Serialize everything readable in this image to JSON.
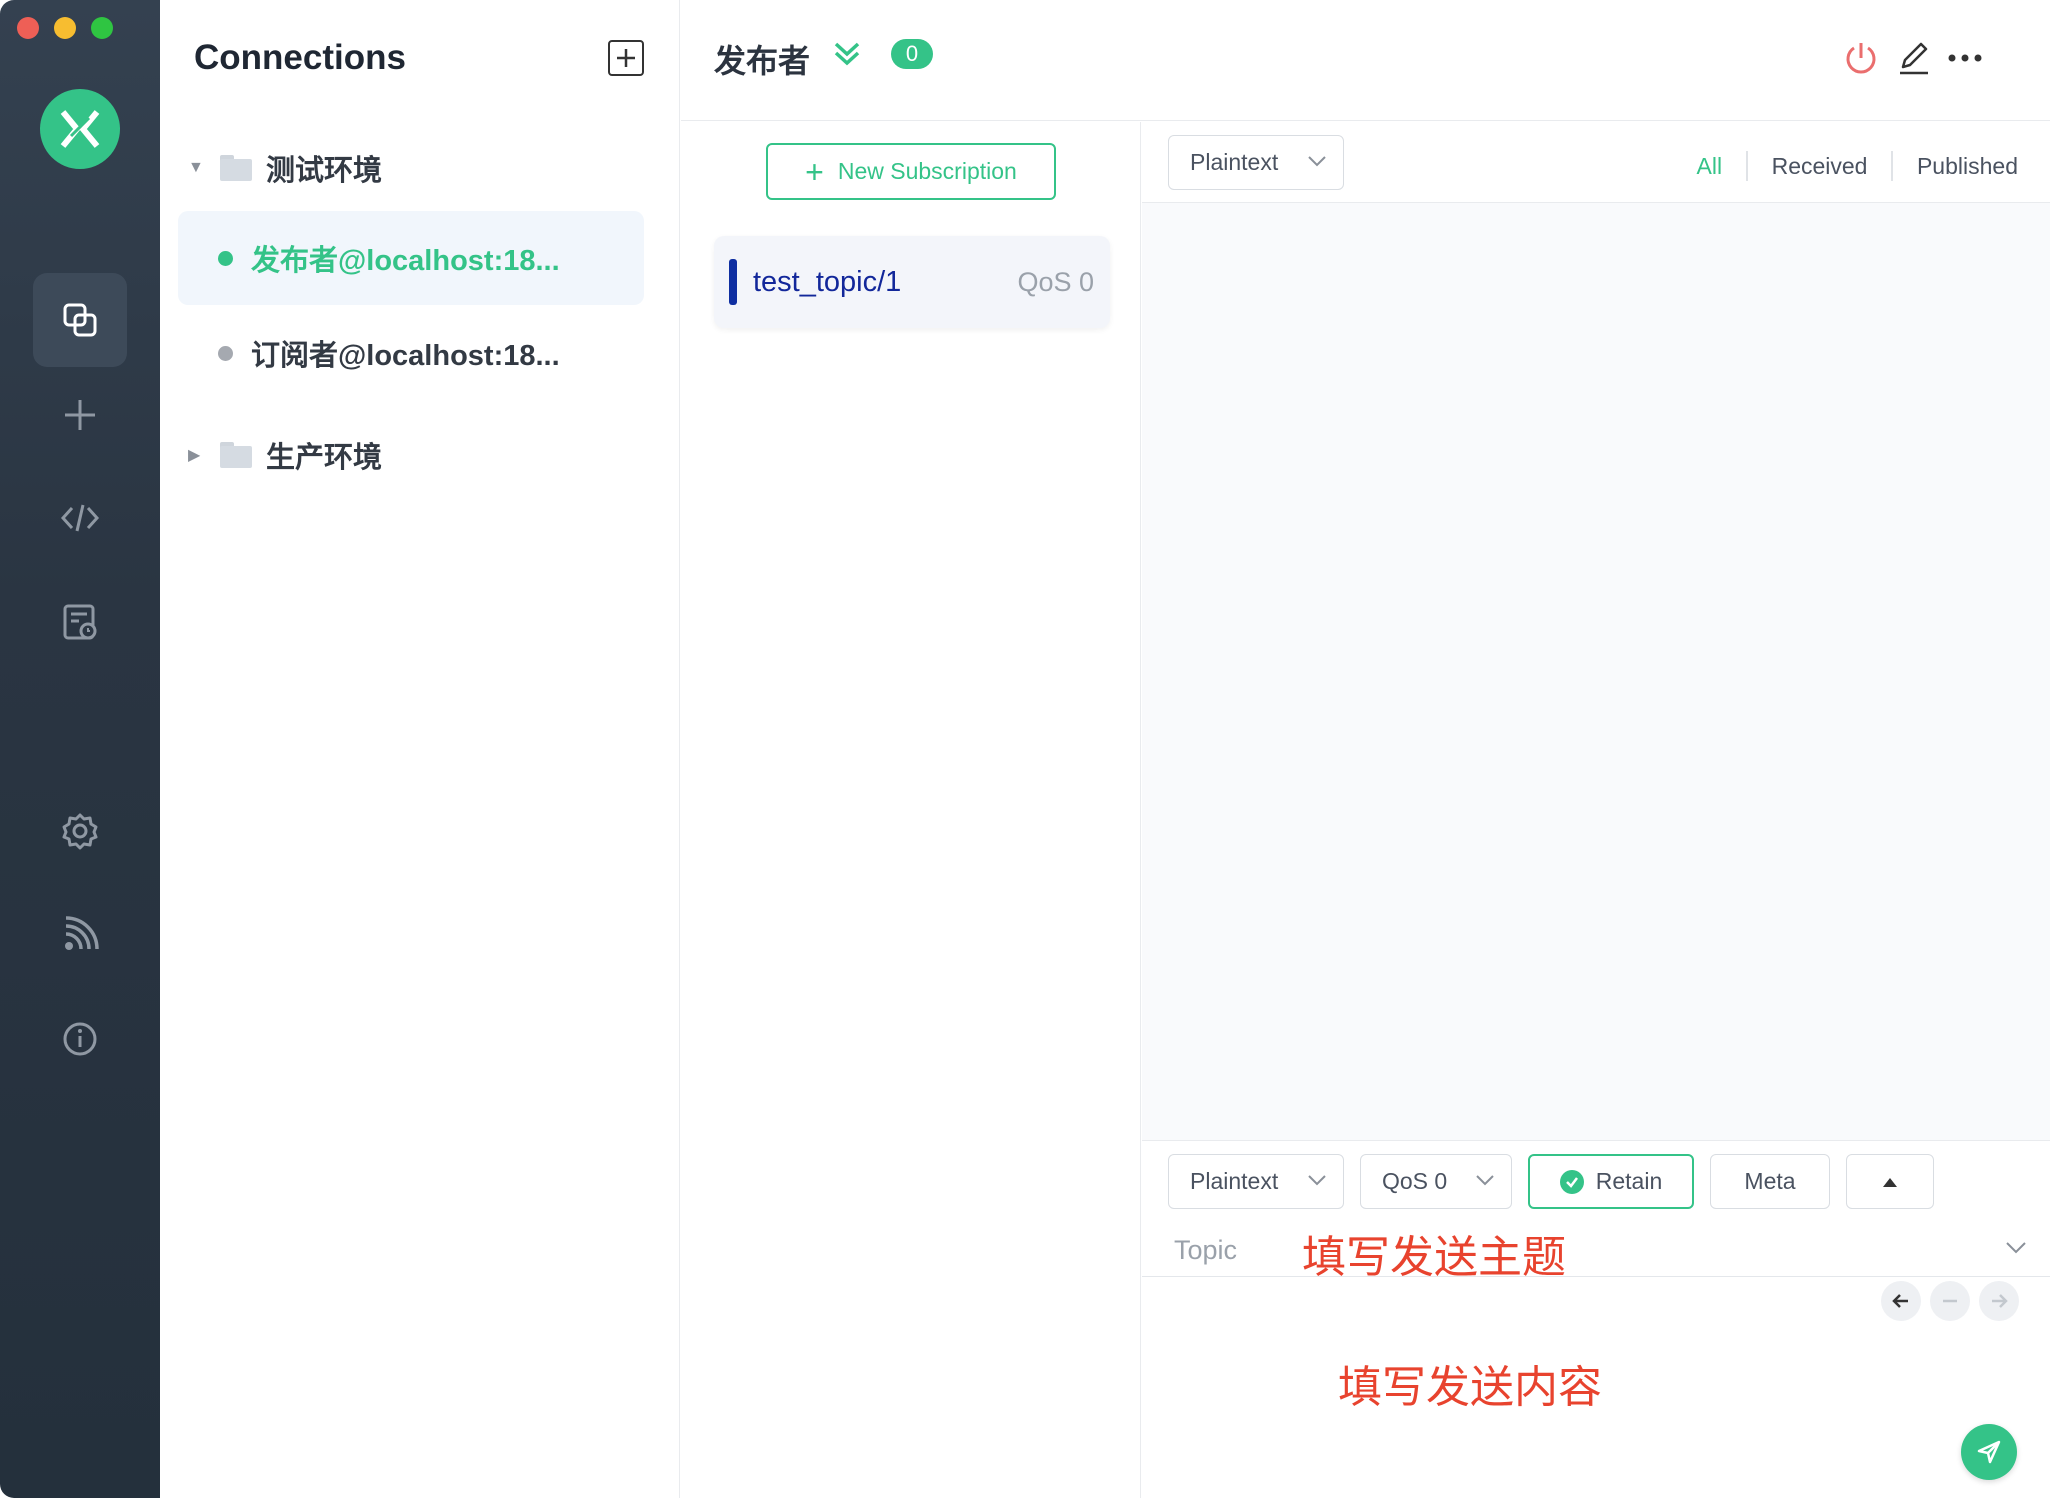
{
  "sidebar": {
    "title": "Connections",
    "groups": [
      {
        "name": "测试环境",
        "expanded": true,
        "connections": [
          {
            "name": "发布者@localhost:18...",
            "status": "connected",
            "active": true
          },
          {
            "name": "订阅者@localhost:18...",
            "status": "disconnected",
            "active": false
          }
        ]
      },
      {
        "name": "生产环境",
        "expanded": false
      }
    ]
  },
  "rail": {
    "items": [
      "connections-icon",
      "add-icon",
      "code-icon",
      "log-icon",
      "settings-icon",
      "feed-icon",
      "info-icon"
    ]
  },
  "header": {
    "title": "发布者",
    "badge": "0"
  },
  "subscriptions": {
    "new_label": "New Subscription",
    "items": [
      {
        "topic": "test_topic/1",
        "qos": "QoS 0",
        "color": "#0f2fa1"
      }
    ]
  },
  "messages": {
    "format": "Plaintext",
    "filters": [
      "All",
      "Received",
      "Published"
    ],
    "active_filter": "All"
  },
  "publish": {
    "format": "Plaintext",
    "qos": "QoS 0",
    "retain_label": "Retain",
    "meta_label": "Meta",
    "topic_label": "Topic",
    "topic_annotation": "填写发送主题",
    "payload_annotation": "填写发送内容"
  },
  "colors": {
    "accent": "#34c388",
    "annotation": "#e8432e",
    "rail": "#2a3542"
  }
}
